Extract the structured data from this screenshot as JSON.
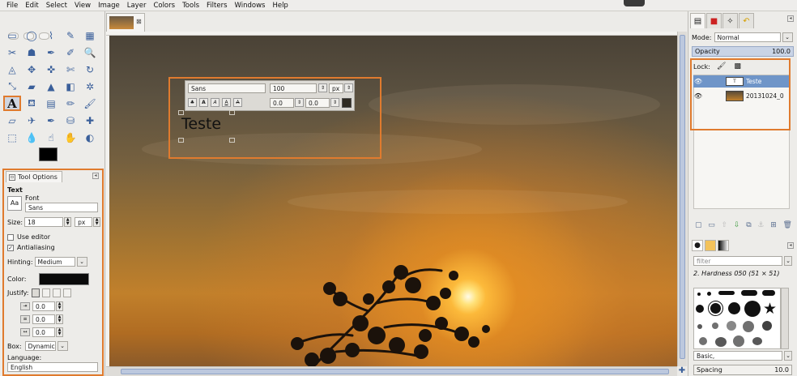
{
  "menubar": {
    "items": [
      "File",
      "Edit",
      "Select",
      "View",
      "Image",
      "Layer",
      "Colors",
      "Tools",
      "Filters",
      "Windows",
      "Help"
    ]
  },
  "toolbox": {
    "tools": [
      {
        "name": "rect-select-icon",
        "glyph": "▭"
      },
      {
        "name": "ellipse-select-icon",
        "glyph": "◯"
      },
      {
        "name": "free-select-icon",
        "glyph": "⌇"
      },
      {
        "name": "fuzzy-select-icon",
        "glyph": "✎"
      },
      {
        "name": "color-select-icon",
        "glyph": "▦"
      },
      {
        "name": "scissors-icon",
        "glyph": "✂"
      },
      {
        "name": "foreground-select-icon",
        "glyph": "☗"
      },
      {
        "name": "paths-icon",
        "glyph": "✒"
      },
      {
        "name": "color-picker-icon",
        "glyph": "✐"
      },
      {
        "name": "zoom-icon",
        "glyph": "🔍"
      },
      {
        "name": "measure-icon",
        "glyph": "◬"
      },
      {
        "name": "move-icon",
        "glyph": "✥"
      },
      {
        "name": "align-icon",
        "glyph": "✜"
      },
      {
        "name": "crop-icon",
        "glyph": "✄"
      },
      {
        "name": "rotate-icon",
        "glyph": "↻"
      },
      {
        "name": "scale-icon",
        "glyph": "⤡"
      },
      {
        "name": "shear-icon",
        "glyph": "▰"
      },
      {
        "name": "perspective-icon",
        "glyph": "▲"
      },
      {
        "name": "flip-icon",
        "glyph": "◧"
      },
      {
        "name": "cage-icon",
        "glyph": "✲"
      },
      {
        "name": "text-icon",
        "glyph": "A",
        "active": true
      },
      {
        "name": "bucket-fill-icon",
        "glyph": "⛾"
      },
      {
        "name": "blend-icon",
        "glyph": "▤"
      },
      {
        "name": "pencil-icon",
        "glyph": "✏"
      },
      {
        "name": "paintbrush-icon",
        "glyph": "🖌"
      },
      {
        "name": "eraser-icon",
        "glyph": "▱"
      },
      {
        "name": "airbrush-icon",
        "glyph": "✈"
      },
      {
        "name": "ink-icon",
        "glyph": "✒"
      },
      {
        "name": "clone-icon",
        "glyph": "⛁"
      },
      {
        "name": "heal-icon",
        "glyph": "✚"
      },
      {
        "name": "perspective-clone-icon",
        "glyph": "⬚"
      },
      {
        "name": "blur-icon",
        "glyph": "💧"
      },
      {
        "name": "smudge-icon",
        "glyph": "☝"
      },
      {
        "name": "dodge-burn-icon",
        "glyph": "✋"
      },
      {
        "name": "desaturate-icon",
        "glyph": "◐"
      }
    ]
  },
  "tool_options": {
    "tab_label": "Tool Options",
    "section": "Text",
    "font_label": "Font",
    "font_value": "Sans",
    "size_label": "Size:",
    "size_value": "18",
    "size_unit": "px",
    "use_editor": "Use editor",
    "use_editor_checked": false,
    "antialiasing": "Antialiasing",
    "antialiasing_checked": true,
    "hinting_label": "Hinting:",
    "hinting_value": "Medium",
    "color_label": "Color:",
    "color_value": "#0a0a0a",
    "justify_label": "Justify:",
    "indent_value": "0.0",
    "line_spacing_value": "0.0",
    "letter_spacing_value": "0.0",
    "box_label": "Box:",
    "box_value": "Dynamic",
    "language_label": "Language:",
    "language_value": "English"
  },
  "canvas": {
    "text_toolbar": {
      "font": "Sans",
      "size": "100",
      "unit": "px",
      "baseline": "0.0",
      "kerning": "0.0"
    },
    "layer_text": "Teste"
  },
  "layers": {
    "mode_label": "Mode:",
    "mode_value": "Normal",
    "opacity_label": "Opacity",
    "opacity_value": "100.0",
    "lock_label": "Lock:",
    "items": [
      {
        "name": "Teste",
        "selected": true
      },
      {
        "name": "20131024_0",
        "selected": false
      }
    ]
  },
  "brushes": {
    "filter_placeholder": "filter",
    "current": "2. Hardness 050 (51 × 51)",
    "preset": "Basic,",
    "spacing_label": "Spacing",
    "spacing_value": "10.0"
  },
  "colors": {
    "accent": "#e07b2e",
    "selection": "#6f95c8"
  }
}
